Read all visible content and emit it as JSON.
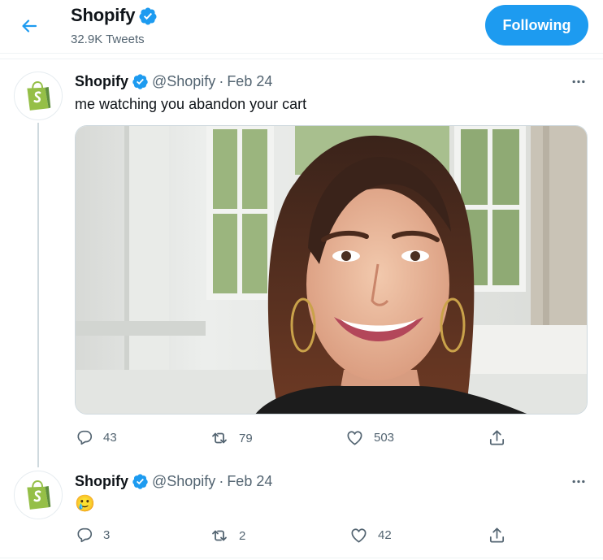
{
  "header": {
    "name": "Shopify",
    "tweet_count": "32.9K Tweets",
    "follow_label": "Following"
  },
  "colors": {
    "accent": "#1d9bf0",
    "shopify_green": "#95bf47",
    "secondary_text": "#536471"
  },
  "tweets": [
    {
      "author": "Shopify",
      "handle": "@Shopify",
      "separator": "·",
      "date": "Feb 24",
      "text": "me watching you abandon your cart",
      "has_media": true,
      "replies": "43",
      "retweets": "79",
      "likes": "503"
    },
    {
      "author": "Shopify",
      "handle": "@Shopify",
      "separator": "·",
      "date": "Feb 24",
      "text": "🥲",
      "has_media": false,
      "replies": "3",
      "retweets": "2",
      "likes": "42"
    }
  ]
}
